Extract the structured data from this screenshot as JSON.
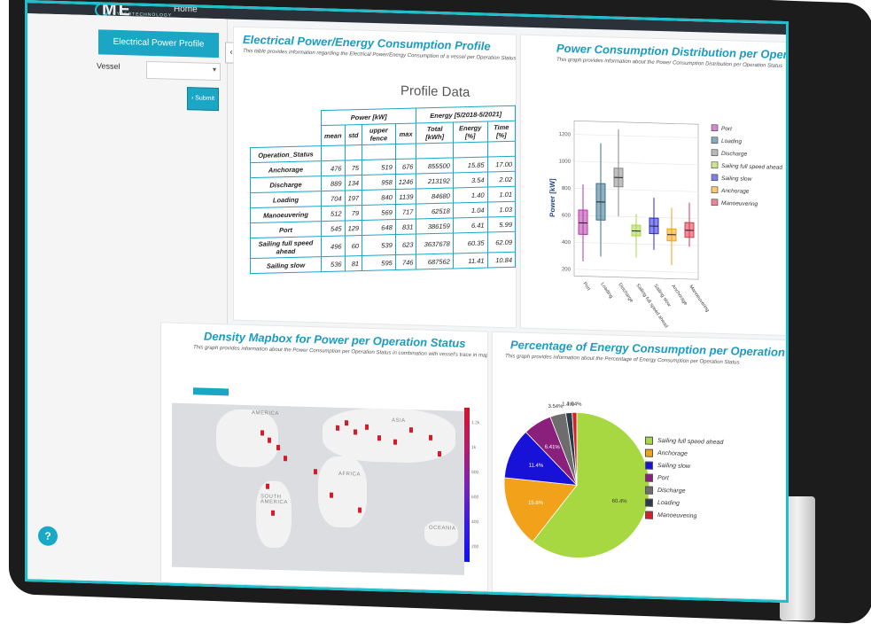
{
  "header": {
    "logo": "ME",
    "logo_sub": "CYBERTECHNOLOGY",
    "home": "Home"
  },
  "sidebar": {
    "title": "Electrical Power Profile",
    "vessel_label": "Vessel",
    "vessel_value": "",
    "submit_label": "Submit",
    "help": "?"
  },
  "profile": {
    "title": "Electrical Power/Energy Consumption Profile",
    "desc": "This table provides information regarding the Electrical Power/Energy Consumption of a vessel per Operation Status in kW and kWh respectively",
    "table_title": "Profile Data",
    "group_headers": [
      "Power [kW]",
      "Energy [5/2018-5/2021]"
    ],
    "col_headers": [
      "mean",
      "std",
      "upper fence",
      "max",
      "Total [kWh]",
      "Energy [%]",
      "Time [%]"
    ],
    "row_header": "Operation_Status",
    "rows": [
      {
        "status": "Anchorage",
        "values": [
          "476",
          "75",
          "519",
          "676",
          "855500",
          "15.85",
          "17.00"
        ]
      },
      {
        "status": "Discharge",
        "values": [
          "889",
          "134",
          "958",
          "1246",
          "213192",
          "3.54",
          "2.02"
        ]
      },
      {
        "status": "Loading",
        "values": [
          "704",
          "197",
          "840",
          "1139",
          "84680",
          "1.40",
          "1.01"
        ]
      },
      {
        "status": "Manoeuvering",
        "values": [
          "512",
          "79",
          "569",
          "717",
          "62518",
          "1.04",
          "1.03"
        ]
      },
      {
        "status": "Port",
        "values": [
          "545",
          "129",
          "648",
          "831",
          "386159",
          "6.41",
          "5.99"
        ]
      },
      {
        "status": "Sailing full speed ahead",
        "values": [
          "496",
          "60",
          "539",
          "623",
          "3637678",
          "60.35",
          "62.09"
        ]
      },
      {
        "status": "Sailing slow",
        "values": [
          "536",
          "81",
          "595",
          "746",
          "687562",
          "11.41",
          "10.84"
        ]
      }
    ]
  },
  "boxplot": {
    "title": "Power Consumption Distribution per Operation Status",
    "desc": "This graph provides information about the Power Consumption Distribution per Operation Status"
  },
  "mapbox": {
    "title": "Density Mapbox for Power per Operation Status",
    "desc": "This graph provides information about the Power Consumption per Operation Status in combination with vessel's trace in map",
    "labels": [
      "AMERICA",
      "ASIA",
      "AFRICA",
      "SOUTH AMERICA",
      "OCEANIA"
    ],
    "colorbar_ticks": [
      "1.2k",
      "1k",
      "800",
      "600",
      "400",
      "200"
    ]
  },
  "pie": {
    "title": "Percentage of Energy Consumption per Operation Status",
    "desc": "This graph provides information about the Percentage of Energy Consumption per Operation Status",
    "slice_labels": [
      "60.4%",
      "15.8%",
      "11.4%",
      "6.41%",
      "3.54%",
      "1.4%",
      "1.04%"
    ]
  },
  "chart_data": [
    {
      "type": "box",
      "title": "Power Consumption Distribution per Operation Status",
      "ylabel": "Power [kW]",
      "ylim": [
        150,
        1300
      ],
      "categories": [
        "Port",
        "Loading",
        "Discharge",
        "Sailing full speed ahead",
        "Sailing slow",
        "Anchorage",
        "Manoeuvering"
      ],
      "ytick_labels": [
        "200",
        "400",
        "600",
        "800",
        "1000",
        "1200"
      ],
      "legend_position": "right",
      "series": [
        {
          "name": "Port",
          "color": "#b23aa8",
          "q1": 460,
          "median": 545,
          "q3": 640,
          "low": 260,
          "high": 831
        },
        {
          "name": "Loading",
          "color": "#3a6f8a",
          "q1": 570,
          "median": 704,
          "q3": 840,
          "low": 300,
          "high": 1139
        },
        {
          "name": "Discharge",
          "color": "#8a8a8a",
          "q1": 820,
          "median": 889,
          "q3": 958,
          "low": 600,
          "high": 1246
        },
        {
          "name": "Sailing full speed ahead",
          "color": "#a8d841",
          "q1": 460,
          "median": 496,
          "q3": 539,
          "low": 300,
          "high": 623
        },
        {
          "name": "Sailing slow",
          "color": "#2a2ad6",
          "q1": 480,
          "median": 536,
          "q3": 595,
          "low": 360,
          "high": 746
        },
        {
          "name": "Anchorage",
          "color": "#f2a21a",
          "q1": 430,
          "median": 476,
          "q3": 519,
          "low": 250,
          "high": 676
        },
        {
          "name": "Manoeuvering",
          "color": "#e0344b",
          "q1": 460,
          "median": 512,
          "q3": 569,
          "low": 390,
          "high": 717
        }
      ]
    },
    {
      "type": "pie",
      "title": "Percentage of Energy Consumption per Operation Status",
      "legend_position": "right",
      "categories": [
        "Sailing full speed ahead",
        "Anchorage",
        "Sailing slow",
        "Port",
        "Discharge",
        "Loading",
        "Manoeuvering"
      ],
      "values": [
        60.4,
        15.8,
        11.4,
        6.41,
        3.54,
        1.4,
        1.04
      ],
      "colors": [
        "#a8d841",
        "#f2a21a",
        "#1812d9",
        "#8a1f7c",
        "#6d6d6d",
        "#2c3b48",
        "#d41f2c"
      ]
    }
  ]
}
